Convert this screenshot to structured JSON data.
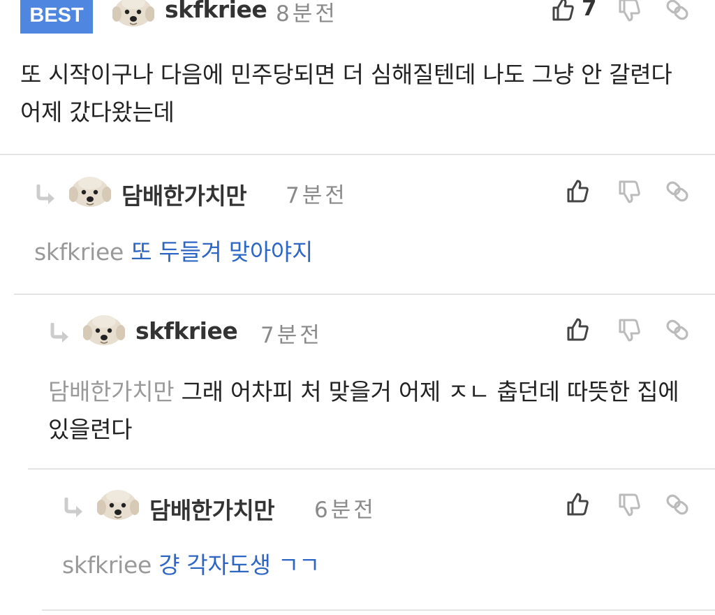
{
  "colors": {
    "best_badge": "#4f86e0",
    "mention": "#999999",
    "reply_text": "#2e66c6",
    "divider": "#e3e3e3"
  },
  "comments": [
    {
      "badge": "BEST",
      "nickname": "skfkriee",
      "time": "8분전",
      "like_count": "7",
      "mention": "",
      "text": "또 시작이구나 다음에 민주당되면 더 심해질텐데 나도 그냥 안 갈련다 어제 갔다왔는데",
      "icons": [
        "avatar-dog",
        "thumbs-up-icon",
        "thumbs-down-icon",
        "link-icon"
      ]
    },
    {
      "nickname": "담배한가치만",
      "time": "7분전",
      "mention": "skfkriee",
      "text": "또 두들겨 맞아야지"
    },
    {
      "nickname": "skfkriee",
      "time": "7분전",
      "mention": "담배한가치만",
      "text": "그래 어차피 처 맞을거 어제 ㅈㄴ 춥던데 따뜻한 집에 있을련다"
    },
    {
      "nickname": "담배한가치만",
      "time": "6분전",
      "mention": "skfkriee",
      "text": "걍 각자도생 ㄱㄱ"
    }
  ]
}
